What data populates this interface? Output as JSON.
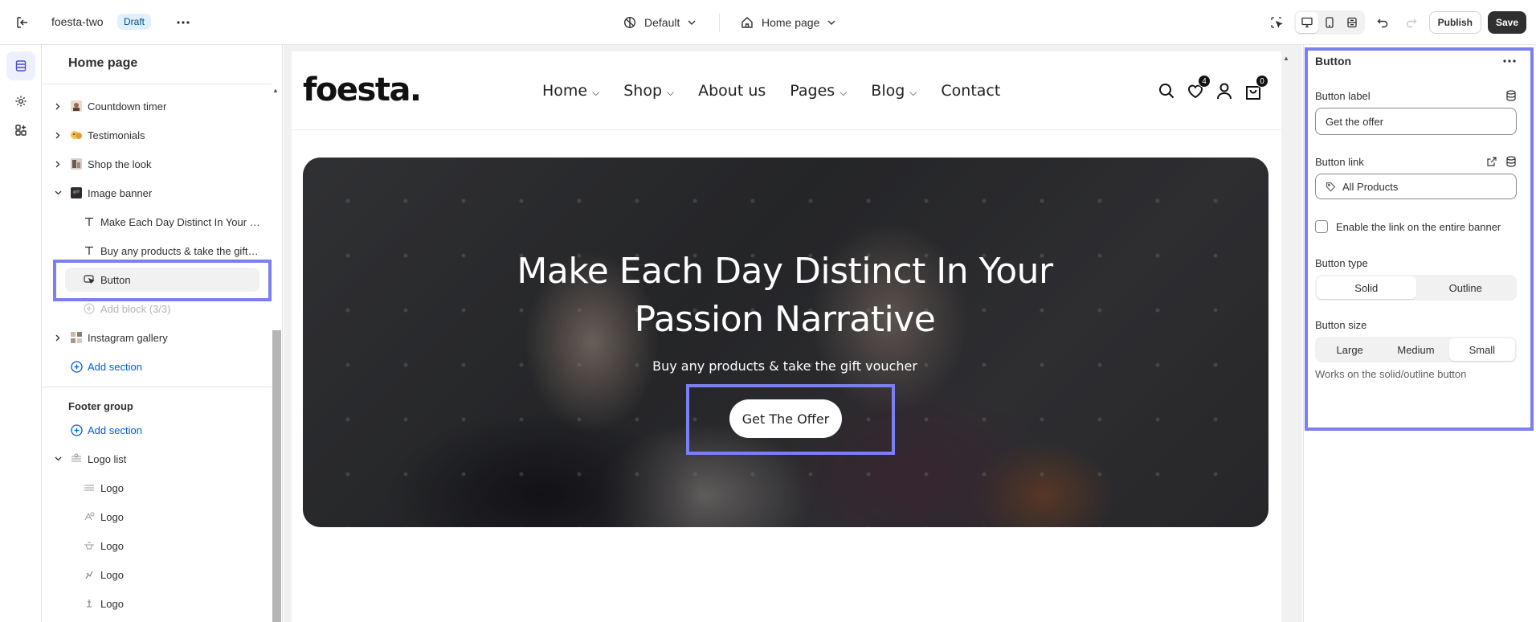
{
  "topbar": {
    "store_name": "foesta-two",
    "status_badge": "Draft",
    "theme_selector": "Default",
    "page_selector": "Home page",
    "publish_label": "Publish",
    "save_label": "Save"
  },
  "sidebar": {
    "title": "Home page",
    "sections": [
      {
        "label": "Countdown timer",
        "icon": "countdown-thumb-icon"
      },
      {
        "label": "Testimonials",
        "icon": "testimonials-thumb-icon"
      },
      {
        "label": "Shop the look",
        "icon": "shop-the-look-thumb-icon"
      },
      {
        "label": "Image banner",
        "icon": "image-banner-thumb-icon"
      }
    ],
    "banner_blocks": [
      {
        "label": "Make Each Day Distinct In Your Passion Narrative",
        "icon": "text-icon"
      },
      {
        "label": "Buy any products & take the gift voucher",
        "icon": "text-icon"
      },
      {
        "label": "Button",
        "icon": "button-cursor-icon"
      }
    ],
    "add_block": "Add block (3/3)",
    "instagram": "Instagram gallery",
    "add_section": "Add section",
    "footer_group": "Footer group",
    "footer_add_section": "Add section",
    "logo_list": "Logo list",
    "logos": [
      "Logo",
      "Logo",
      "Logo",
      "Logo",
      "Logo"
    ]
  },
  "preview": {
    "logo": "foesta.",
    "nav": [
      {
        "label": "Home",
        "dropdown": true
      },
      {
        "label": "Shop",
        "dropdown": true
      },
      {
        "label": "About us",
        "dropdown": false
      },
      {
        "label": "Pages",
        "dropdown": true
      },
      {
        "label": "Blog",
        "dropdown": true
      },
      {
        "label": "Contact",
        "dropdown": false
      }
    ],
    "wishlist_count": "4",
    "cart_count": "0",
    "banner_heading": "Make Each Day Distinct In Your Passion Narrative",
    "banner_subtext": "Buy any products & take the gift voucher",
    "banner_button": "Get The Offer"
  },
  "settings": {
    "title": "Button",
    "button_label_title": "Button label",
    "button_label_value": "Get the offer",
    "button_link_title": "Button link",
    "button_link_value": "All Products",
    "enable_link_label": "Enable the link on the entire banner",
    "button_type_title": "Button type",
    "button_type_options": [
      "Solid",
      "Outline"
    ],
    "button_type_selected": "Solid",
    "button_size_title": "Button size",
    "button_size_options": [
      "Large",
      "Medium",
      "Small"
    ],
    "button_size_selected": "Small",
    "button_size_help": "Works on the solid/outline button"
  },
  "colors": {
    "highlight": "#7c7ff0",
    "link": "#005bd3",
    "save_bg": "#303030"
  }
}
